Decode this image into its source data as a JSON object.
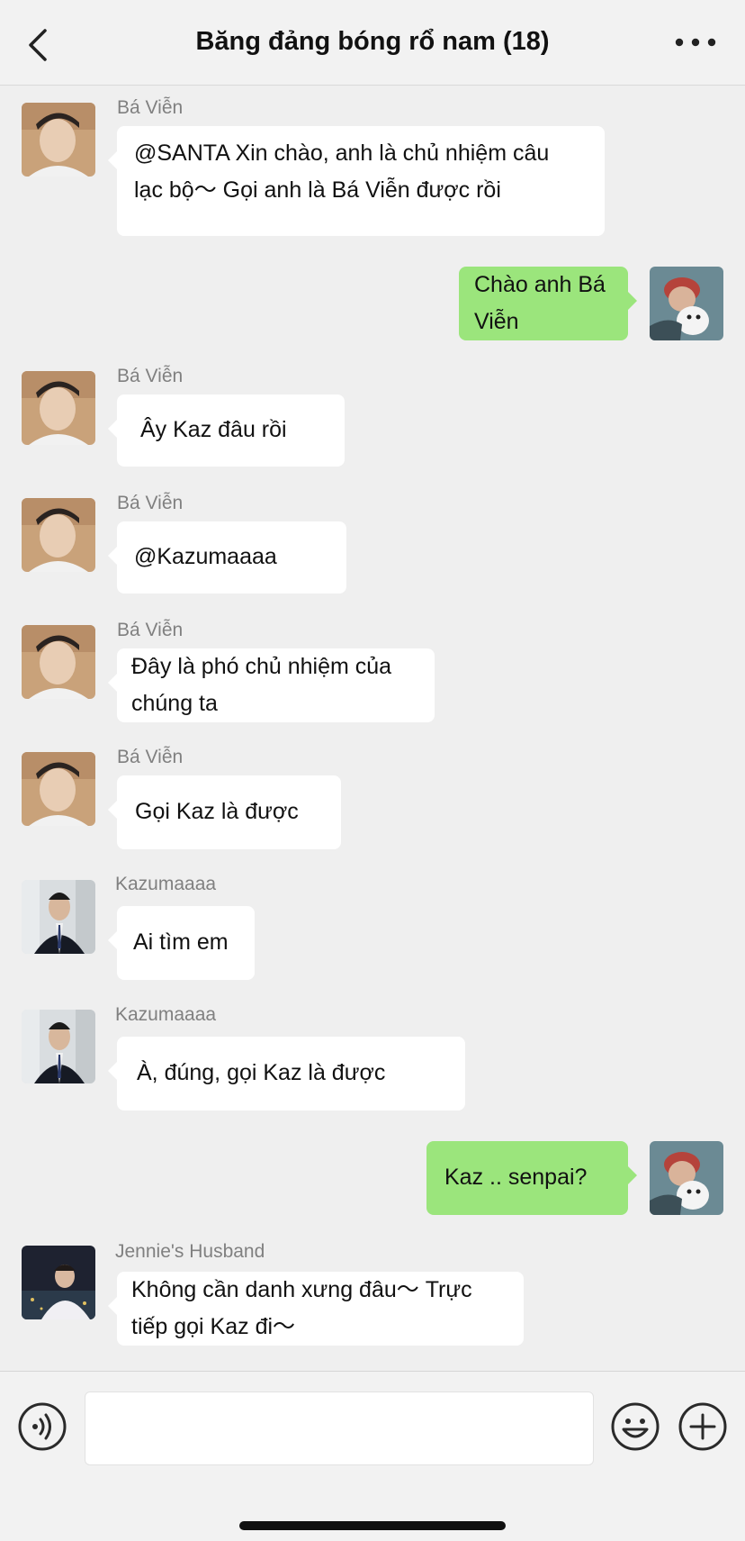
{
  "header": {
    "title": "Băng đảng bóng rổ nam (18)",
    "back_icon": "chevron-left-icon",
    "more_icon": "ellipsis-icon"
  },
  "colors": {
    "sent_bubble": "#9be57c",
    "received_bubble": "#ffffff",
    "background": "#efefef"
  },
  "messages": [
    {
      "sender": "Bá Viễn",
      "direction": "incoming",
      "text": [
        "@SANTA Xin chào, anh là chủ nhiệm câu",
        "lạc bộ〜 Gọi anh là Bá Viễn được rồi"
      ]
    },
    {
      "sender": "",
      "direction": "outgoing",
      "text": [
        "Chào anh Bá",
        "Viễn"
      ]
    },
    {
      "sender": "Bá Viễn",
      "direction": "incoming",
      "text": [
        "Ây Kaz đâu rồi"
      ]
    },
    {
      "sender": "Bá Viễn",
      "direction": "incoming",
      "text": [
        "@Kazumaaaa"
      ]
    },
    {
      "sender": "Bá Viễn",
      "direction": "incoming",
      "text": [
        "Đây là phó chủ nhiệm của",
        "chúng ta"
      ]
    },
    {
      "sender": "Bá Viễn",
      "direction": "incoming",
      "text": [
        "Gọi Kaz là được"
      ]
    },
    {
      "sender": "Kazumaaaa",
      "direction": "incoming",
      "text": [
        "Ai tìm em"
      ]
    },
    {
      "sender": "Kazumaaaa",
      "direction": "incoming",
      "text": [
        "À, đúng, gọi Kaz là được"
      ]
    },
    {
      "sender": "",
      "direction": "outgoing",
      "text": [
        "Kaz .. senpai?"
      ]
    },
    {
      "sender": "Jennie's Husband",
      "direction": "incoming",
      "text": [
        "Không cần danh xưng đâu〜 Trực",
        "tiếp gọi Kaz đi〜"
      ]
    }
  ],
  "input_bar": {
    "voice_icon": "voice-icon",
    "message_value": "",
    "emoji_icon": "emoji-icon",
    "plus_icon": "plus-icon"
  }
}
